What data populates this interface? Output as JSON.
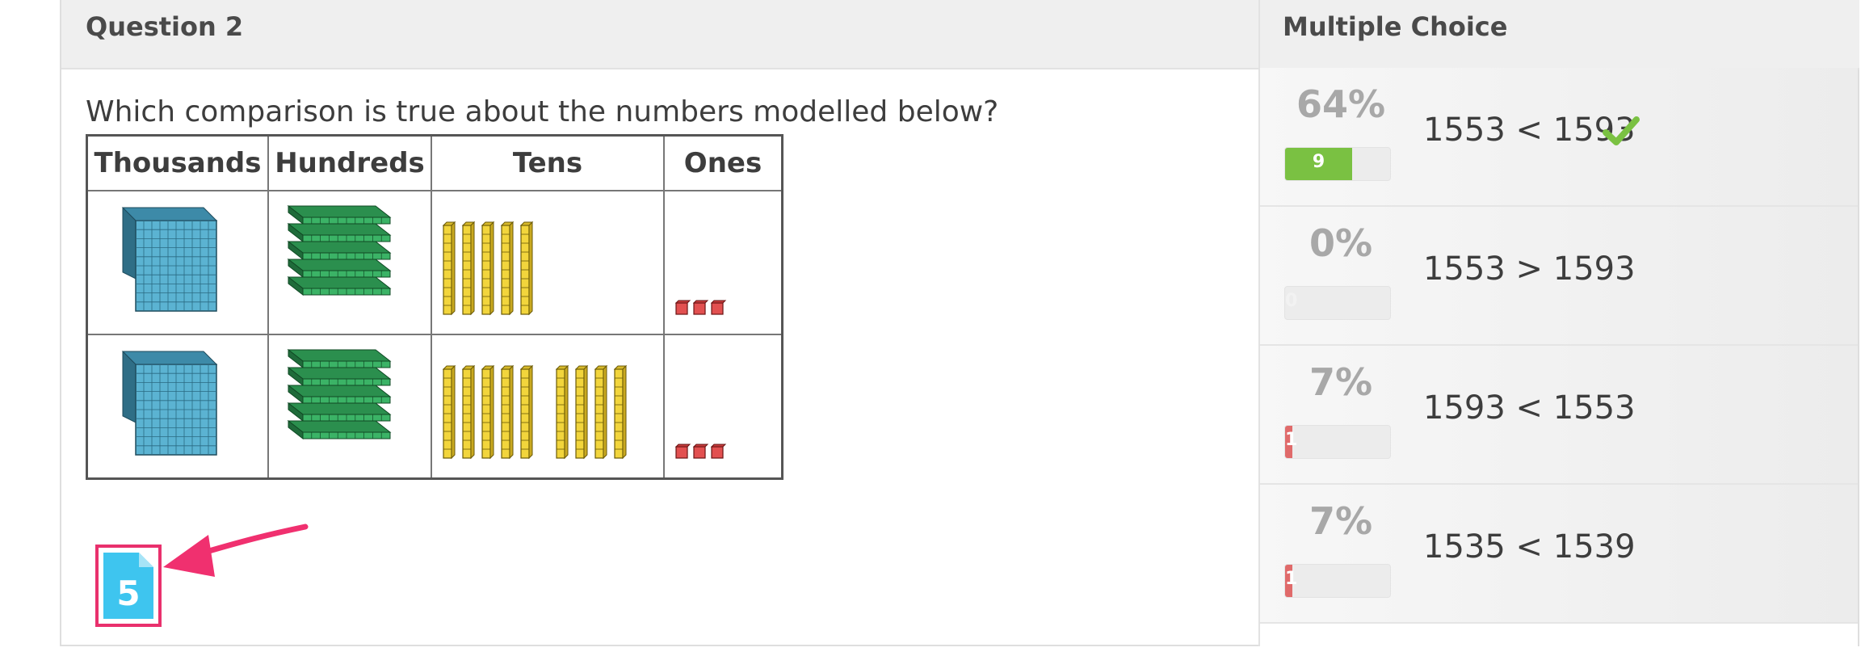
{
  "question_panel": {
    "title": "Question 2",
    "prompt": "Which comparison is true about the numbers modelled below?",
    "table": {
      "headers": [
        "Thousands",
        "Hundreds",
        "Tens",
        "Ones"
      ],
      "rows": [
        {
          "thousands": 1,
          "hundreds": 5,
          "tens": 5,
          "ones": 3
        },
        {
          "thousands": 1,
          "hundreds": 5,
          "tens": 9,
          "ones": 3
        }
      ]
    },
    "badge_number": "5"
  },
  "answers_panel": {
    "title": "Multiple Choice",
    "choices": [
      {
        "percent": "64%",
        "count": "9",
        "fraction": 0.64,
        "text": "1553 < 1593",
        "correct": true,
        "bar_color": "#7ac142"
      },
      {
        "percent": "0%",
        "count": "0",
        "fraction": 0.0,
        "text": "1553 > 1593",
        "correct": false,
        "bar_color": "#e06a6a"
      },
      {
        "percent": "7%",
        "count": "1",
        "fraction": 0.07,
        "text": "1593 < 1553",
        "correct": false,
        "bar_color": "#e06a6a"
      },
      {
        "percent": "7%",
        "count": "1",
        "fraction": 0.07,
        "text": "1535 < 1539",
        "correct": false,
        "bar_color": "#e06a6a"
      }
    ]
  },
  "colors": {
    "header_bg": "#efefef",
    "correct_green": "#7ac142",
    "wrong_red": "#e06a6a",
    "highlight_pink": "#e9306d",
    "badge_blue": "#3ec5ef"
  },
  "icons": {
    "flag": "flag-icon",
    "check": "checkmark-icon",
    "document": "document-icon",
    "arrow": "pointer-arrow-icon"
  }
}
